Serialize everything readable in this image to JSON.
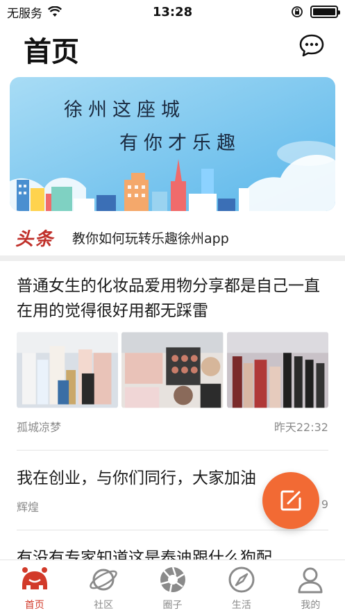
{
  "status_bar": {
    "carrier": "无服务",
    "time": "13:28"
  },
  "header": {
    "title": "首页",
    "message_icon": "chat-bubble-icon"
  },
  "banner": {
    "line1": "徐州这座城",
    "line2": "有你才乐趣"
  },
  "headline": {
    "logo": "头条",
    "text": "教你如何玩转乐趣徐州app"
  },
  "feed": [
    {
      "title": "普通女生的化妆品爱用物分享都是自己一直在用的觉得很好用都无踩雷",
      "author": "孤城凉梦",
      "time": "昨天22:32"
    },
    {
      "title": "我在创业，与你们同行，大家加油",
      "author": "辉煌",
      "time": "9"
    },
    {
      "title": "有没有专家知道这是泰迪跟什么狗配"
    }
  ],
  "tabs": [
    {
      "label": "首页",
      "icon": "home-icon"
    },
    {
      "label": "社区",
      "icon": "planet-icon"
    },
    {
      "label": "圈子",
      "icon": "aperture-icon"
    },
    {
      "label": "生活",
      "icon": "compass-icon"
    },
    {
      "label": "我的",
      "icon": "person-icon"
    }
  ],
  "colors": {
    "accent": "#d23a2a",
    "fab": "#f26a34",
    "banner_sky": "#7ec8ef"
  }
}
